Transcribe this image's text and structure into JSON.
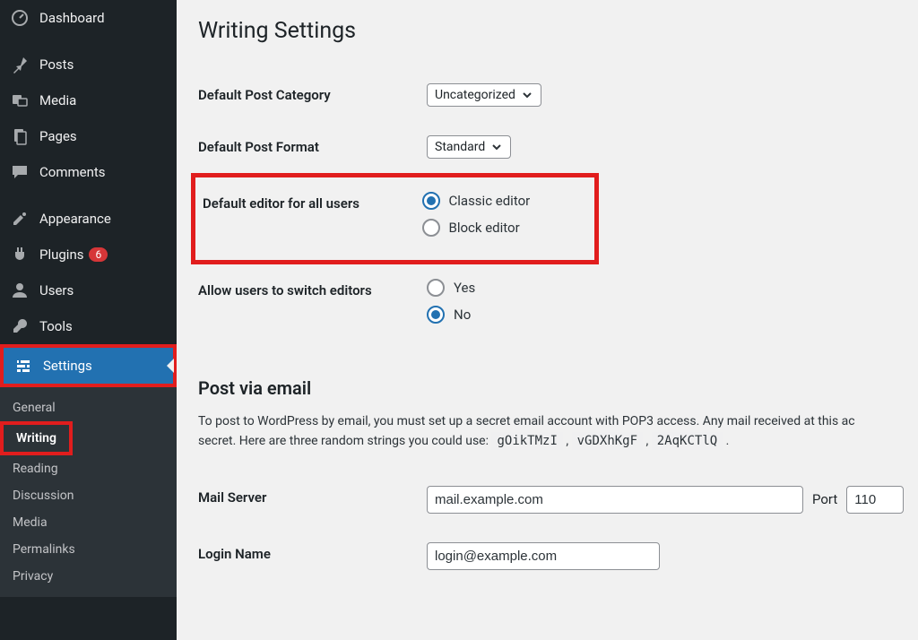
{
  "sidebar": {
    "top": [
      {
        "label": "Dashboard"
      },
      {
        "label": "Posts"
      },
      {
        "label": "Media"
      },
      {
        "label": "Pages"
      },
      {
        "label": "Comments"
      }
    ],
    "mid": [
      {
        "label": "Appearance"
      },
      {
        "label": "Plugins",
        "badge": "6"
      },
      {
        "label": "Users"
      },
      {
        "label": "Tools"
      },
      {
        "label": "Settings",
        "active": true
      }
    ],
    "sub": [
      {
        "label": "General"
      },
      {
        "label": "Writing",
        "current": true
      },
      {
        "label": "Reading"
      },
      {
        "label": "Discussion"
      },
      {
        "label": "Media"
      },
      {
        "label": "Permalinks"
      },
      {
        "label": "Privacy"
      }
    ]
  },
  "page": {
    "title": "Writing Settings",
    "fields": {
      "default_category": {
        "label": "Default Post Category",
        "value": "Uncategorized"
      },
      "default_format": {
        "label": "Default Post Format",
        "value": "Standard"
      },
      "default_editor": {
        "label": "Default editor for all users",
        "options": [
          "Classic editor",
          "Block editor"
        ],
        "selected": "Classic editor"
      },
      "allow_switch": {
        "label": "Allow users to switch editors",
        "options": [
          "Yes",
          "No"
        ],
        "selected": "No"
      }
    },
    "post_via_email": {
      "heading": "Post via email",
      "desc_pre": "To post to WordPress by email, you must set up a secret email account with POP3 access. Any mail received at this ac",
      "desc_mid": "secret. Here are three random strings you could use: ",
      "codes": [
        "gOikTMzI",
        "vGDXhKgF",
        "2AqKCTlQ"
      ],
      "mail_server": {
        "label": "Mail Server",
        "value": "mail.example.com",
        "port_label": "Port",
        "port": "110"
      },
      "login_name": {
        "label": "Login Name",
        "value": "login@example.com"
      }
    }
  }
}
